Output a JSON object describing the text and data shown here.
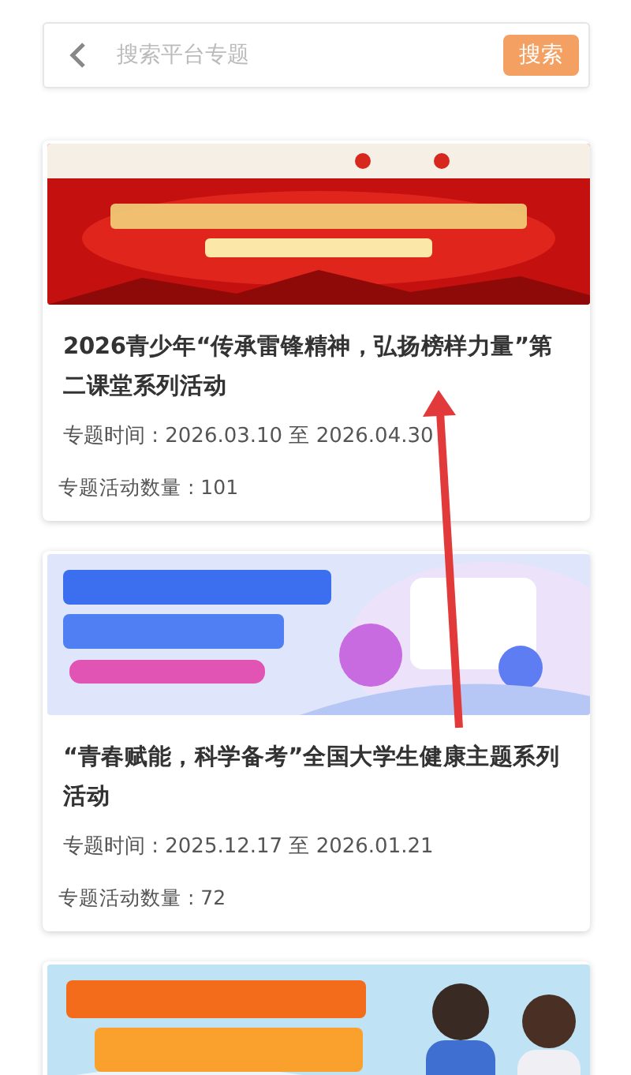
{
  "search": {
    "placeholder": "搜索平台专题",
    "button": "搜索"
  },
  "topics": [
    {
      "banner": {
        "kind": "picture"
      },
      "title": "2026青少年“传承雷锋精神，弘扬榜样力量”第二课堂系列活动",
      "time": "专题时间 : 2026.03.10 至 2026.04.30",
      "count": "专题活动数量 : 101"
    },
    {
      "banner": {
        "kind": "picture"
      },
      "title": "“青春赋能，科学备考”全国大学生健康主题系列活动",
      "time": "专题时间 : 2025.12.17 至 2026.01.21",
      "count": "专题活动数量 : 72"
    },
    {
      "banner": {
        "kind": "picture"
      }
    }
  ],
  "annotation": {
    "kind": "arrow"
  }
}
